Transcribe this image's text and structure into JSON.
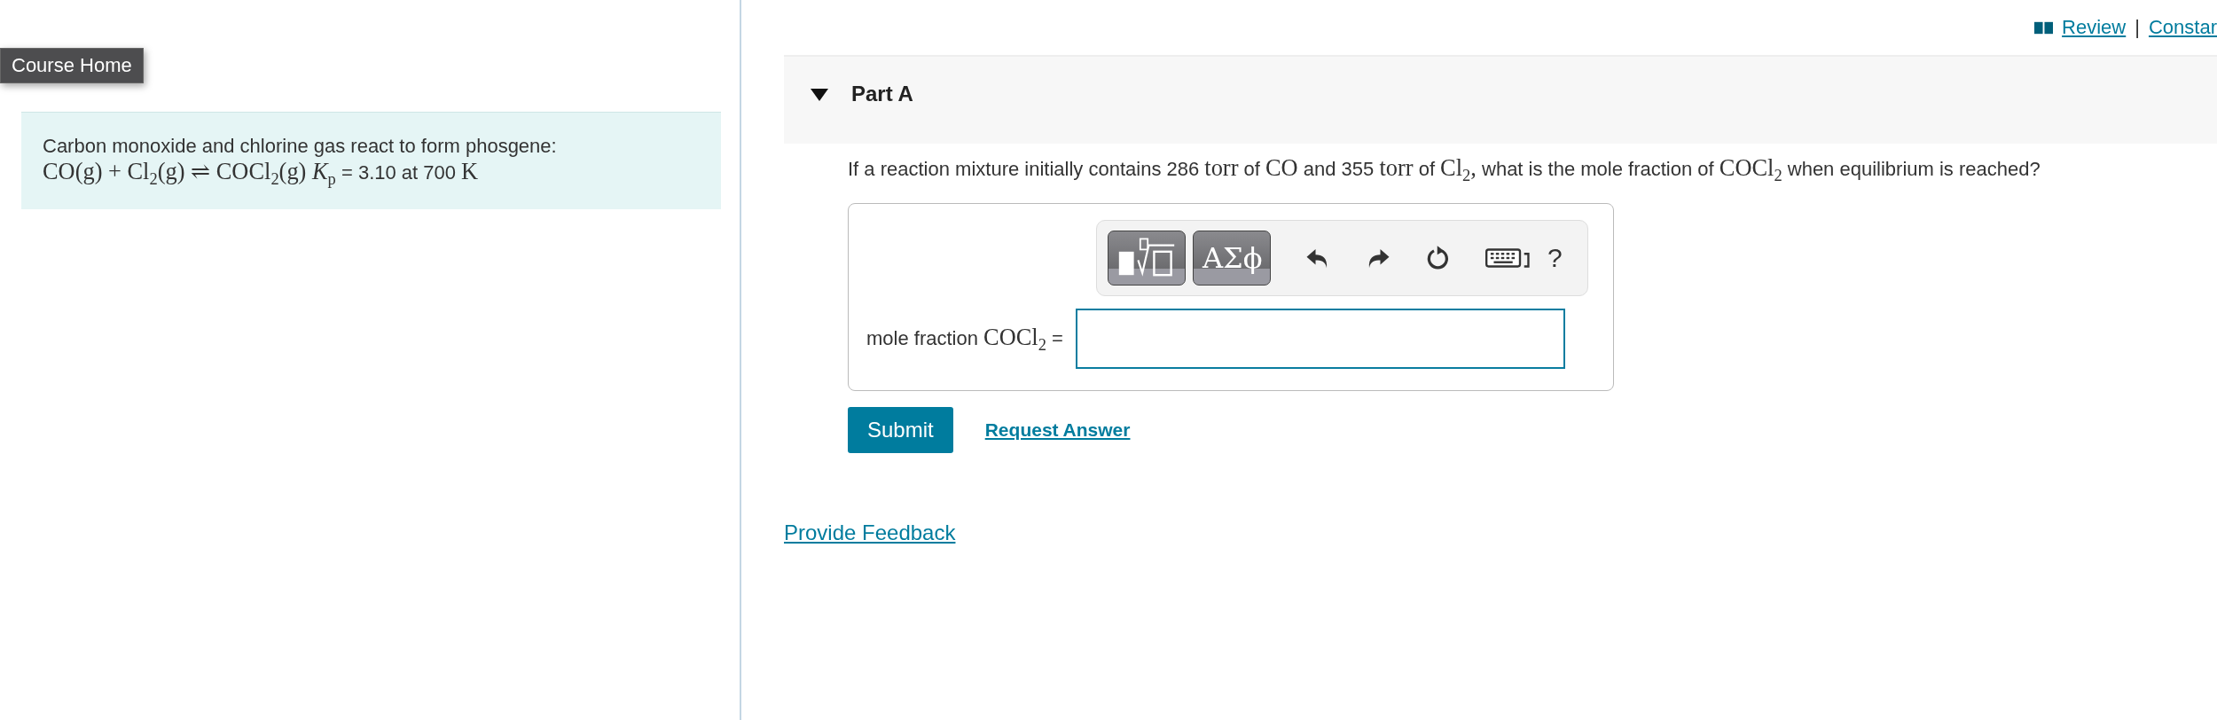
{
  "top_links": [
    {
      "label": "Review",
      "kind": "book"
    },
    {
      "label": "|",
      "kind": "separator"
    },
    {
      "label": "Constar",
      "kind": "link"
    }
  ],
  "course_home": "Course Home",
  "intro": {
    "lines": [
      [
        {
          "kind": "plain",
          "text": "Carbon monoxide and chlorine gas react to form phosgene:"
        }
      ],
      [
        {
          "kind": "math",
          "text": "CO(g) + Cl$_{2}$(g) ⇌ COCl$_{2}$(g) *K*$_{p}$"
        },
        {
          "kind": "plain",
          "text": " = 3.10 at 700 "
        },
        {
          "kind": "math",
          "text": "K"
        }
      ]
    ]
  },
  "part": {
    "title": "Part A",
    "expanded": true,
    "question": [
      {
        "kind": "plain",
        "text": "If a reaction mixture initially contains 286 "
      },
      {
        "kind": "math",
        "text": "torr"
      },
      {
        "kind": "plain",
        "text": " of "
      },
      {
        "kind": "math",
        "text": "CO"
      },
      {
        "kind": "plain",
        "text": " and 355 "
      },
      {
        "kind": "math",
        "text": "torr"
      },
      {
        "kind": "plain",
        "text": " of "
      },
      {
        "kind": "math",
        "text": "Cl$_{2}$,"
      },
      {
        "kind": "plain",
        "text": " what is the mole fraction of "
      },
      {
        "kind": "math",
        "text": "COCl$_{2}$"
      },
      {
        "kind": "plain",
        "text": " when equilibrium is reached?"
      }
    ],
    "toolbar": [
      {
        "kind": "templates"
      },
      {
        "kind": "greek",
        "label": "ΑΣϕ"
      },
      {
        "kind": "undo"
      },
      {
        "kind": "redo"
      },
      {
        "kind": "reset"
      },
      {
        "kind": "keyboard"
      },
      {
        "kind": "help",
        "label": "?"
      }
    ],
    "answer_label": [
      {
        "kind": "plain",
        "text": "mole fraction "
      },
      {
        "kind": "math",
        "text": "COCl$_{2}$"
      },
      {
        "kind": "plain",
        "text": " ="
      }
    ],
    "submit": "Submit",
    "request_answer": "Request Answer"
  },
  "feedback_link": "Provide Feedback"
}
